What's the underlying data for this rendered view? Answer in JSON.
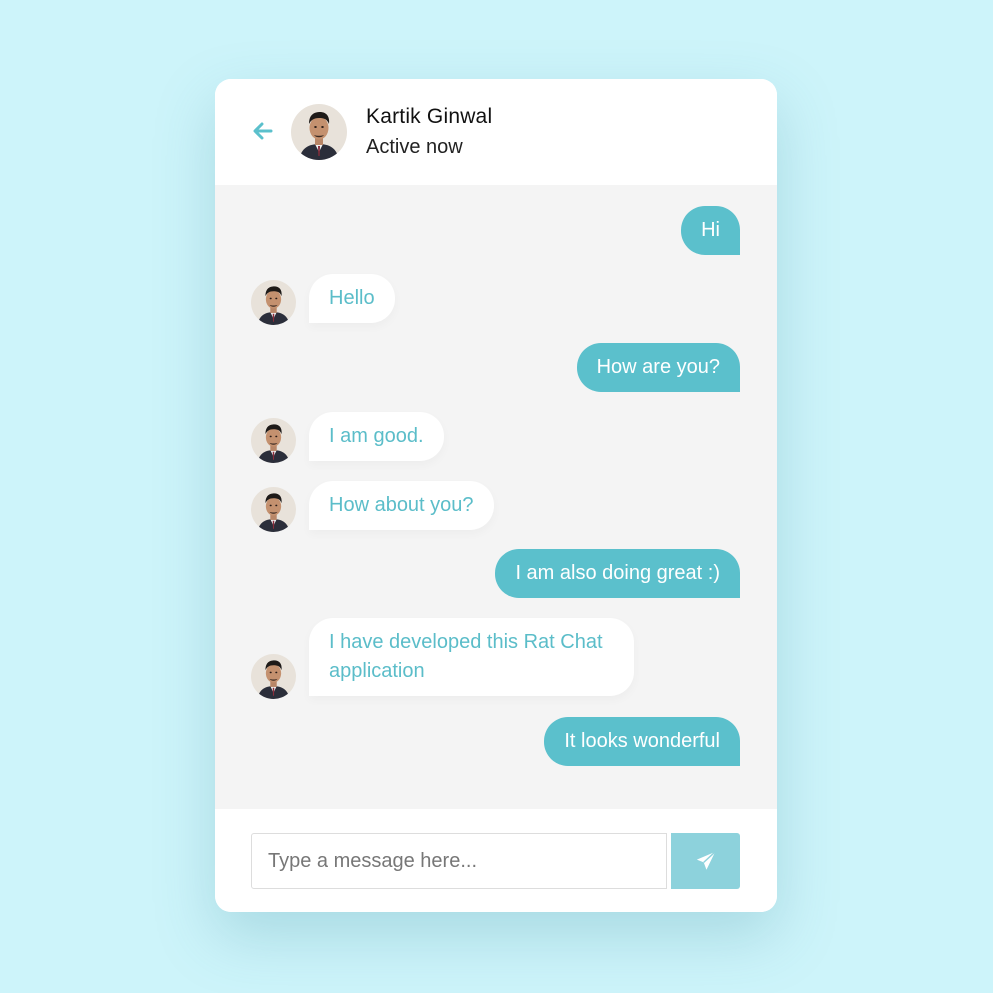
{
  "header": {
    "name": "Kartik Ginwal",
    "status": "Active now",
    "back_icon": "arrow-left-icon"
  },
  "messages": [
    {
      "from": "me",
      "text": "Hi"
    },
    {
      "from": "them",
      "text": "Hello"
    },
    {
      "from": "me",
      "text": "How are you?"
    },
    {
      "from": "them",
      "text": "I am good."
    },
    {
      "from": "them",
      "text": "How about you?"
    },
    {
      "from": "me",
      "text": "I am also doing great :)"
    },
    {
      "from": "them",
      "text": "I have developed this Rat Chat application"
    },
    {
      "from": "me",
      "text": "It looks wonderful"
    }
  ],
  "composer": {
    "placeholder": "Type a message here...",
    "send_icon": "paper-plane-icon"
  },
  "colors": {
    "background": "#cdf4fa",
    "accent": "#5bc0cc",
    "send_button": "#8dd2dc",
    "chat_area": "#f4f4f4"
  }
}
